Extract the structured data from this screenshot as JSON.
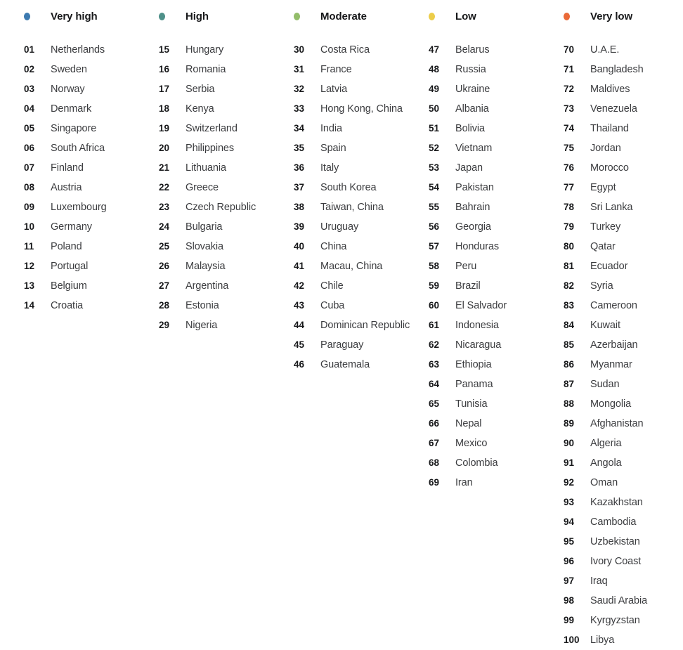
{
  "legend": {
    "columns": [
      {
        "id": "very-high",
        "label": "Very high",
        "color": "#3d7ab0",
        "dot_icon": "legend-dot-icon",
        "entries": [
          {
            "rank": "01",
            "name": "Netherlands"
          },
          {
            "rank": "02",
            "name": "Sweden"
          },
          {
            "rank": "03",
            "name": "Norway"
          },
          {
            "rank": "04",
            "name": "Denmark"
          },
          {
            "rank": "05",
            "name": "Singapore"
          },
          {
            "rank": "06",
            "name": "South Africa"
          },
          {
            "rank": "07",
            "name": "Finland"
          },
          {
            "rank": "08",
            "name": "Austria"
          },
          {
            "rank": "09",
            "name": "Luxembourg"
          },
          {
            "rank": "10",
            "name": "Germany"
          },
          {
            "rank": "11",
            "name": "Poland"
          },
          {
            "rank": "12",
            "name": "Portugal"
          },
          {
            "rank": "13",
            "name": "Belgium"
          },
          {
            "rank": "14",
            "name": "Croatia"
          }
        ]
      },
      {
        "id": "high",
        "label": "High",
        "color": "#4e9089",
        "dot_icon": "legend-dot-icon",
        "entries": [
          {
            "rank": "15",
            "name": "Hungary"
          },
          {
            "rank": "16",
            "name": "Romania"
          },
          {
            "rank": "17",
            "name": "Serbia"
          },
          {
            "rank": "18",
            "name": "Kenya"
          },
          {
            "rank": "19",
            "name": "Switzerland"
          },
          {
            "rank": "20",
            "name": "Philippines"
          },
          {
            "rank": "21",
            "name": "Lithuania"
          },
          {
            "rank": "22",
            "name": "Greece"
          },
          {
            "rank": "23",
            "name": "Czech Republic"
          },
          {
            "rank": "24",
            "name": "Bulgaria"
          },
          {
            "rank": "25",
            "name": "Slovakia"
          },
          {
            "rank": "26",
            "name": "Malaysia"
          },
          {
            "rank": "27",
            "name": "Argentina"
          },
          {
            "rank": "28",
            "name": "Estonia"
          },
          {
            "rank": "29",
            "name": "Nigeria"
          }
        ]
      },
      {
        "id": "moderate",
        "label": "Moderate",
        "color": "#93bd6a",
        "dot_icon": "legend-dot-icon",
        "entries": [
          {
            "rank": "30",
            "name": "Costa Rica"
          },
          {
            "rank": "31",
            "name": "France"
          },
          {
            "rank": "32",
            "name": "Latvia"
          },
          {
            "rank": "33",
            "name": "Hong Kong, China"
          },
          {
            "rank": "34",
            "name": "India"
          },
          {
            "rank": "35",
            "name": "Spain"
          },
          {
            "rank": "36",
            "name": "Italy"
          },
          {
            "rank": "37",
            "name": "South Korea"
          },
          {
            "rank": "38",
            "name": "Taiwan, China"
          },
          {
            "rank": "39",
            "name": "Uruguay"
          },
          {
            "rank": "40",
            "name": "China"
          },
          {
            "rank": "41",
            "name": "Macau, China"
          },
          {
            "rank": "42",
            "name": "Chile"
          },
          {
            "rank": "43",
            "name": "Cuba"
          },
          {
            "rank": "44",
            "name": "Dominican Republic"
          },
          {
            "rank": "45",
            "name": "Paraguay"
          },
          {
            "rank": "46",
            "name": "Guatemala"
          }
        ]
      },
      {
        "id": "low",
        "label": "Low",
        "color": "#eccd4a",
        "dot_icon": "legend-dot-icon",
        "entries": [
          {
            "rank": "47",
            "name": "Belarus"
          },
          {
            "rank": "48",
            "name": "Russia"
          },
          {
            "rank": "49",
            "name": "Ukraine"
          },
          {
            "rank": "50",
            "name": "Albania"
          },
          {
            "rank": "51",
            "name": "Bolivia"
          },
          {
            "rank": "52",
            "name": "Vietnam"
          },
          {
            "rank": "53",
            "name": "Japan"
          },
          {
            "rank": "54",
            "name": "Pakistan"
          },
          {
            "rank": "55",
            "name": "Bahrain"
          },
          {
            "rank": "56",
            "name": "Georgia"
          },
          {
            "rank": "57",
            "name": "Honduras"
          },
          {
            "rank": "58",
            "name": "Peru"
          },
          {
            "rank": "59",
            "name": "Brazil"
          },
          {
            "rank": "60",
            "name": "El Salvador"
          },
          {
            "rank": "61",
            "name": "Indonesia"
          },
          {
            "rank": "62",
            "name": "Nicaragua"
          },
          {
            "rank": "63",
            "name": "Ethiopia"
          },
          {
            "rank": "64",
            "name": "Panama"
          },
          {
            "rank": "65",
            "name": "Tunisia"
          },
          {
            "rank": "66",
            "name": "Nepal"
          },
          {
            "rank": "67",
            "name": "Mexico"
          },
          {
            "rank": "68",
            "name": "Colombia"
          },
          {
            "rank": "69",
            "name": "Iran"
          }
        ]
      },
      {
        "id": "very-low",
        "label": "Very low",
        "color": "#ea6a38",
        "dot_icon": "legend-dot-icon",
        "entries": [
          {
            "rank": "70",
            "name": "U.A.E."
          },
          {
            "rank": "71",
            "name": "Bangladesh"
          },
          {
            "rank": "72",
            "name": "Maldives"
          },
          {
            "rank": "73",
            "name": "Venezuela"
          },
          {
            "rank": "74",
            "name": "Thailand"
          },
          {
            "rank": "75",
            "name": "Jordan"
          },
          {
            "rank": "76",
            "name": "Morocco"
          },
          {
            "rank": "77",
            "name": "Egypt"
          },
          {
            "rank": "78",
            "name": "Sri Lanka"
          },
          {
            "rank": "79",
            "name": "Turkey"
          },
          {
            "rank": "80",
            "name": "Qatar"
          },
          {
            "rank": "81",
            "name": "Ecuador"
          },
          {
            "rank": "82",
            "name": "Syria"
          },
          {
            "rank": "83",
            "name": "Cameroon"
          },
          {
            "rank": "84",
            "name": "Kuwait"
          },
          {
            "rank": "85",
            "name": "Azerbaijan"
          },
          {
            "rank": "86",
            "name": "Myanmar"
          },
          {
            "rank": "87",
            "name": "Sudan"
          },
          {
            "rank": "88",
            "name": "Mongolia"
          },
          {
            "rank": "89",
            "name": "Afghanistan"
          },
          {
            "rank": "90",
            "name": "Algeria"
          },
          {
            "rank": "91",
            "name": "Angola"
          },
          {
            "rank": "92",
            "name": "Oman"
          },
          {
            "rank": "93",
            "name": "Kazakhstan"
          },
          {
            "rank": "94",
            "name": "Cambodia"
          },
          {
            "rank": "95",
            "name": "Uzbekistan"
          },
          {
            "rank": "96",
            "name": "Ivory Coast"
          },
          {
            "rank": "97",
            "name": "Iraq"
          },
          {
            "rank": "98",
            "name": "Saudi Arabia"
          },
          {
            "rank": "99",
            "name": "Kyrgyzstan"
          },
          {
            "rank": "100",
            "name": "Libya"
          }
        ]
      }
    ]
  }
}
